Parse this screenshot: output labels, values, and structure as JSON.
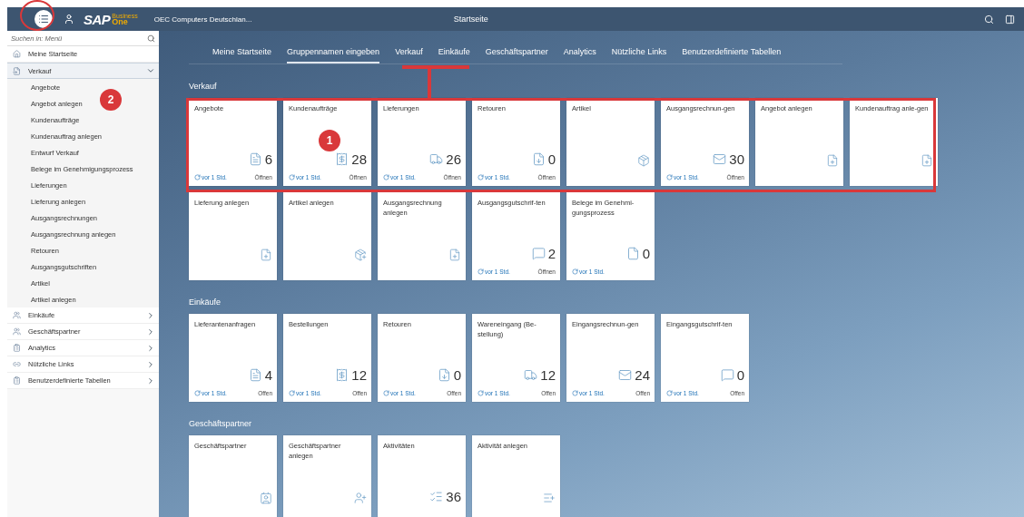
{
  "header": {
    "logo_main": "SAP",
    "logo_top": "Business",
    "logo_bottom": "One",
    "company": "OEC Computers Deutschlan...",
    "title": "Startseite"
  },
  "sidebar": {
    "search": {
      "placeholder": "Suchen in: Menü"
    },
    "annotation_badge": "2",
    "items": [
      {
        "label": "Meine Startseite",
        "kind": "home"
      },
      {
        "label": "Verkauf",
        "kind": "sales",
        "expanded": true,
        "children": [
          {
            "label": "Angebote"
          },
          {
            "label": "Angebot anlegen"
          },
          {
            "label": "Kundenaufträge"
          },
          {
            "label": "Kundenauftrag anlegen"
          },
          {
            "label": "Entwurf Verkauf"
          },
          {
            "label": "Belege im Genehmigungsprozess"
          },
          {
            "label": "Lieferungen"
          },
          {
            "label": "Lieferung anlegen"
          },
          {
            "label": "Ausgangsrechnungen"
          },
          {
            "label": "Ausgangsrechnung anlegen"
          },
          {
            "label": "Retouren"
          },
          {
            "label": "Ausgangsgutschriften"
          },
          {
            "label": "Artikel"
          },
          {
            "label": "Artikel anlegen"
          }
        ]
      },
      {
        "label": "Einkäufe",
        "kind": "people",
        "expanded": false
      },
      {
        "label": "Geschäftspartner",
        "kind": "people",
        "expanded": false
      },
      {
        "label": "Analytics",
        "kind": "clipboard",
        "expanded": false
      },
      {
        "label": "Nützliche Links",
        "kind": "link",
        "expanded": false
      },
      {
        "label": "Benutzerdefinierte Tabellen",
        "kind": "clipboard",
        "expanded": false
      }
    ]
  },
  "tabs": [
    {
      "label": "Meine Startseite",
      "selected": false
    },
    {
      "label": "Gruppennamen eingeben",
      "selected": true
    },
    {
      "label": "Verkauf",
      "selected": false
    },
    {
      "label": "Einkäufe",
      "selected": false
    },
    {
      "label": "Geschäftspartner",
      "selected": false
    },
    {
      "label": "Analytics",
      "selected": false
    },
    {
      "label": "Nützliche Links",
      "selected": false
    },
    {
      "label": "Benutzerdefinierte Tabellen",
      "selected": false
    }
  ],
  "groups": [
    {
      "title": "Verkauf",
      "annotation_badge": "1",
      "tiles": [
        {
          "title": "Angebote",
          "kind": "quote",
          "count": "6",
          "refresh": "vor 1 Std.",
          "action": "Öffnen"
        },
        {
          "title": "Kundenaufträge",
          "kind": "order",
          "count": "28",
          "refresh": "vor 1 Std.",
          "action": "Öffnen"
        },
        {
          "title": "Lieferungen",
          "kind": "delivery",
          "count": "26",
          "refresh": "vor 1 Std.",
          "action": "Öffnen"
        },
        {
          "title": "Retouren",
          "kind": "return",
          "count": "0",
          "refresh": "vor 1 Std.",
          "action": "Öffnen"
        },
        {
          "title": "Artikel",
          "kind": "item"
        },
        {
          "title": "Ausgangsrechnun-gen",
          "kind": "invoice",
          "count": "30",
          "refresh": "vor 1 Std.",
          "action": "Öffnen"
        },
        {
          "title": "Angebot anlegen",
          "kind": "create"
        },
        {
          "title": "Kundenauftrag anle-gen",
          "kind": "create"
        },
        {
          "title": "Lieferung anlegen",
          "kind": "create"
        },
        {
          "title": "Artikel anlegen",
          "kind": "itemcreate"
        },
        {
          "title": "Ausgangsrechnung anlegen",
          "kind": "create"
        },
        {
          "title": "Ausgangsgutschrif-ten",
          "kind": "credit",
          "count": "2",
          "refresh": "vor 1 Std.",
          "action": "Öffnen"
        },
        {
          "title": "Belege im Genehmi-gungsprozess",
          "kind": "approval",
          "count": "0",
          "refresh": "vor 1 Std."
        }
      ]
    },
    {
      "title": "Einkäufe",
      "tiles": [
        {
          "title": "Lieferantenanfragen",
          "kind": "quote",
          "count": "4",
          "refresh": "vor 1 Std.",
          "action": "Offen"
        },
        {
          "title": "Bestellungen",
          "kind": "order",
          "count": "12",
          "refresh": "vor 1 Std.",
          "action": "Offen"
        },
        {
          "title": "Retouren",
          "kind": "return",
          "count": "0",
          "refresh": "vor 1 Std.",
          "action": "Offen"
        },
        {
          "title": "Wareneingang (Be-stellung)",
          "kind": "delivery",
          "count": "12",
          "refresh": "vor 1 Std.",
          "action": "Offen"
        },
        {
          "title": "Eingangsrechnun-gen",
          "kind": "invoice",
          "count": "24",
          "refresh": "vor 1 Std.",
          "action": "Offen"
        },
        {
          "title": "Eingangsgutschrif-ten",
          "kind": "credit",
          "count": "0",
          "refresh": "vor 1 Std.",
          "action": "Offen"
        }
      ]
    },
    {
      "title": "Geschäftspartner",
      "tiles": [
        {
          "title": "Geschäftspartner",
          "kind": "partner"
        },
        {
          "title": "Geschäftspartner anlegen",
          "kind": "partnercreate"
        },
        {
          "title": "Aktivitäten",
          "kind": "activity",
          "count": "36"
        },
        {
          "title": "Aktivität anlegen",
          "kind": "activitycreate"
        }
      ]
    }
  ]
}
